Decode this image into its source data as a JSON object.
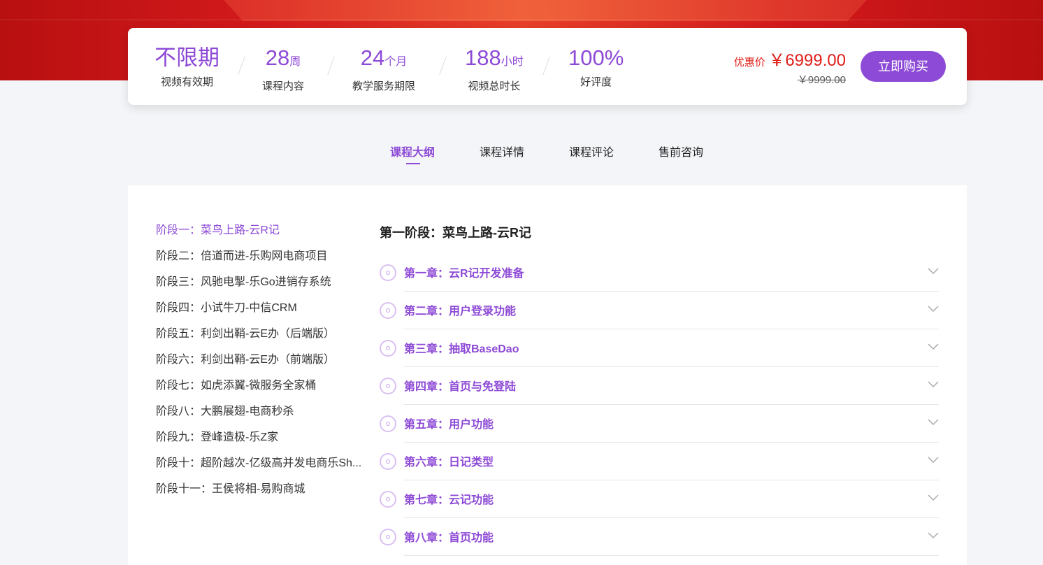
{
  "stats": [
    {
      "value": "不限期",
      "unit": "",
      "label": "视频有效期"
    },
    {
      "value": "28",
      "unit": "周",
      "label": "课程内容"
    },
    {
      "value": "24",
      "unit": "个月",
      "label": "教学服务期限"
    },
    {
      "value": "188",
      "unit": "小时",
      "label": "视频总时长"
    },
    {
      "value": "100%",
      "unit": "",
      "label": "好评度"
    }
  ],
  "price": {
    "discount_label": "优惠价",
    "discount_value": "￥6999.00",
    "original_value": "￥9999.00",
    "buy_label": "立即购买"
  },
  "tabs": [
    {
      "label": "课程大纲",
      "active": true
    },
    {
      "label": "课程详情",
      "active": false
    },
    {
      "label": "课程评论",
      "active": false
    },
    {
      "label": "售前咨询",
      "active": false
    }
  ],
  "stages": [
    {
      "label": "阶段一：菜鸟上路-云R记",
      "active": true
    },
    {
      "label": "阶段二：倍道而进-乐购网电商项目",
      "active": false
    },
    {
      "label": "阶段三：风驰电掣-乐Go进销存系统",
      "active": false
    },
    {
      "label": "阶段四：小试牛刀-中信CRM",
      "active": false
    },
    {
      "label": "阶段五：利剑出鞘-云E办（后端版）",
      "active": false
    },
    {
      "label": "阶段六：利剑出鞘-云E办（前端版）",
      "active": false
    },
    {
      "label": "阶段七：如虎添翼-微服务全家桶",
      "active": false
    },
    {
      "label": "阶段八：大鹏展翅-电商秒杀",
      "active": false
    },
    {
      "label": "阶段九：登峰造极-乐Z家",
      "active": false
    },
    {
      "label": "阶段十：超阶越次-亿级高并发电商乐Sh...",
      "active": false
    },
    {
      "label": "阶段十一：王侯将相-易购商城",
      "active": false
    }
  ],
  "stage_title": "第一阶段：菜鸟上路-云R记",
  "chapters": [
    "第一章：云R记开发准备",
    "第二章：用户登录功能",
    "第三章：抽取BaseDao",
    "第四章：首页与免登陆",
    "第五章：用户功能",
    "第六章：日记类型",
    "第七章：云记功能",
    "第八章：首页功能"
  ],
  "colors": {
    "accent": "#8d4ad6",
    "price": "#e0201a",
    "hero": "#d31a1c"
  }
}
